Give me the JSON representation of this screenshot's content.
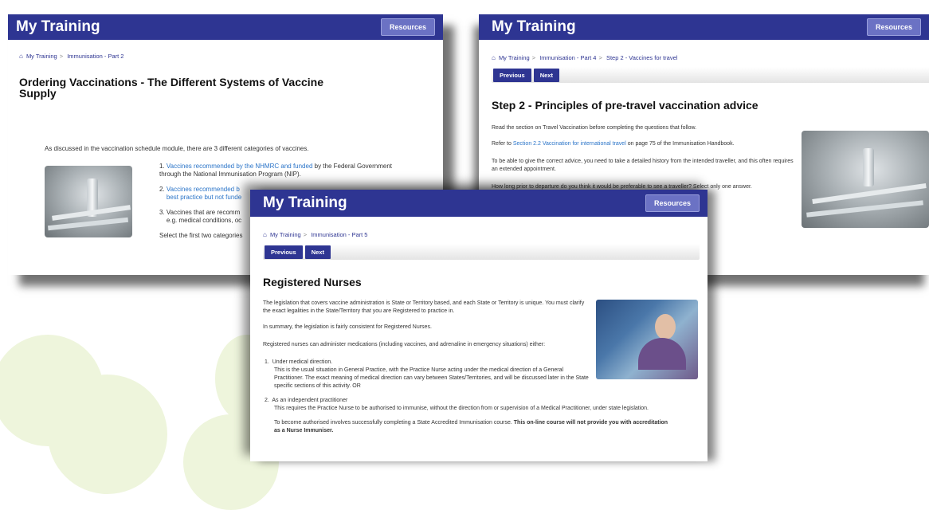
{
  "colors": {
    "brand": "#2e3592",
    "accent": "#6b72c4",
    "link": "#2a74c8",
    "decor": "#eef5dc"
  },
  "card_left": {
    "app_title": "My Training",
    "resources_label": "Resources",
    "breadcrumb": [
      "My Training",
      "Immunisation - Part 2"
    ],
    "heading": "Ordering Vaccinations - The Different Systems of Vaccine Supply",
    "intro": "As discussed in the vaccination schedule module, there are 3 different categories of vaccines.",
    "item1_link": "Vaccines recommended by the NHMRC and funded",
    "item1_rest": " by the Federal Government through the National Immunisation Program (NIP).",
    "item2_link": "Vaccines recommended b",
    "item2_link_line2": "best practice but not funde",
    "item3_a": "Vaccines that are recomm",
    "item3_b": "e.g. medical conditions, oc",
    "select_text": "Select the first two categories"
  },
  "card_right": {
    "app_title": "My Training",
    "resources_label": "Resources",
    "breadcrumb": [
      "My Training",
      "Immunisation - Part 4",
      "Step 2 - Vaccines for travel"
    ],
    "prev_label": "Previous",
    "next_label": "Next",
    "heading": "Step 2 - Principles of pre-travel vaccination advice",
    "para1": "Read the section on Travel Vaccination before completing the questions that follow.",
    "para2_a": "Refer to ",
    "para2_link": "Section 2.2 Vaccination for international travel",
    "para2_b": " on page 75 of the Immunisation Handbook.",
    "para3": "To be able to give the correct advice, you need to take a detailed history from the intended traveller, and this often requires an extended appointment.",
    "para4": "How long prior to departure do you think it would be preferable to see a traveller? Select only one answer."
  },
  "card_front": {
    "app_title": "My Training",
    "resources_label": "Resources",
    "breadcrumb": [
      "My Training",
      "Immunisation - Part 5"
    ],
    "prev_label": "Previous",
    "next_label": "Next",
    "heading": "Registered Nurses",
    "para1": "The legislation that covers vaccine administration is State or Territory based, and each State or Territory is unique. You must clarify the exact legalities in the State/Territory that you are Registered to practice in.",
    "para2": "In summary, the legislation is fairly consistent for Registered Nurses.",
    "para3": "Registered nurses can administer medications (including vaccines, and adrenaline in emergency situations) either:",
    "item1_title": "Under medical direction.",
    "item1_body": "This is the usual situation in General Practice, with the Practice Nurse acting under the medical direction of a General Practitioner. The exact meaning of medical direction can vary between States/Territories, and will be discussed later in the State specific sections of this activity. OR",
    "item2_title": "As an independent practitioner",
    "item2_body": "This requires the Practice Nurse to be authorised to immunise, without the direction from or supervision of a Medical Practitioner, under state legislation.",
    "closing_a": "To become authorised involves successfully completing a State Accredited Immunisation course. ",
    "closing_b": "This on-line course will not provide you with accreditation as a Nurse Immuniser."
  }
}
